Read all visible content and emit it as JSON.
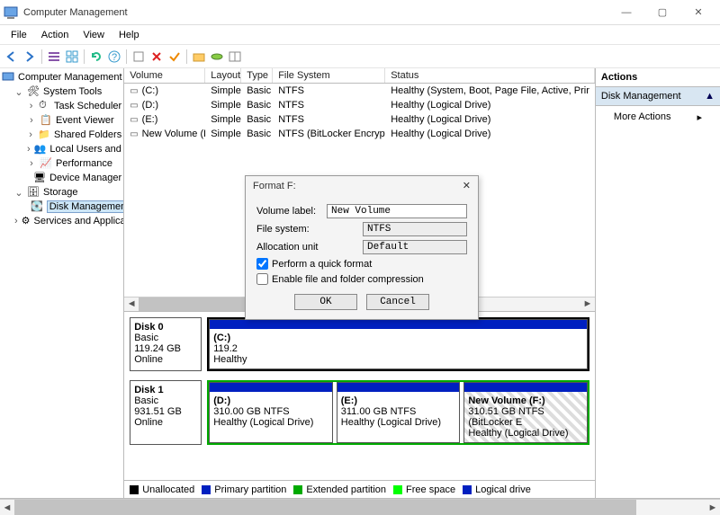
{
  "window": {
    "title": "Computer Management"
  },
  "menu": {
    "items": [
      "File",
      "Action",
      "View",
      "Help"
    ]
  },
  "tree": {
    "root": "Computer Management (Local",
    "sys": "System Tools",
    "sys_children": [
      "Task Scheduler",
      "Event Viewer",
      "Shared Folders",
      "Local Users and Groups",
      "Performance",
      "Device Manager"
    ],
    "storage": "Storage",
    "diskmgmt": "Disk Management",
    "services": "Services and Applications"
  },
  "vol_headers": {
    "v": "Volume",
    "l": "Layout",
    "t": "Type",
    "fs": "File System",
    "s": "Status"
  },
  "volumes": [
    {
      "v": "(C:)",
      "l": "Simple",
      "t": "Basic",
      "fs": "NTFS",
      "s": "Healthy (System, Boot, Page File, Active, Prir"
    },
    {
      "v": "(D:)",
      "l": "Simple",
      "t": "Basic",
      "fs": "NTFS",
      "s": "Healthy (Logical Drive)"
    },
    {
      "v": "(E:)",
      "l": "Simple",
      "t": "Basic",
      "fs": "NTFS",
      "s": "Healthy (Logical Drive)"
    },
    {
      "v": "New Volume (F:)",
      "l": "Simple",
      "t": "Basic",
      "fs": "NTFS (BitLocker Encrypted)",
      "s": "Healthy (Logical Drive)"
    }
  ],
  "disk0": {
    "name": "Disk 0",
    "type": "Basic",
    "size": "119.24 GB",
    "status": "Online",
    "p0": {
      "v": "(C:)",
      "sz": "119.2",
      "st": "Healthy"
    }
  },
  "disk1": {
    "name": "Disk 1",
    "type": "Basic",
    "size": "931.51 GB",
    "status": "Online",
    "p0": {
      "v": "(D:)",
      "sz": "310.00 GB NTFS",
      "st": "Healthy (Logical Drive)"
    },
    "p1": {
      "v": "(E:)",
      "sz": "311.00 GB NTFS",
      "st": "Healthy (Logical Drive)"
    },
    "p2": {
      "v": "New Volume   (F:)",
      "sz": "310.51 GB NTFS (BitLocker E",
      "st": "Healthy (Logical Drive)"
    }
  },
  "legend": {
    "un": "Unallocated",
    "pp": "Primary partition",
    "ep": "Extended partition",
    "fs": "Free space",
    "ld": "Logical drive"
  },
  "actions": {
    "hdr": "Actions",
    "item": "Disk Management",
    "more": "More Actions"
  },
  "dialog": {
    "title": "Format F:",
    "label_lbl": "Volume label:",
    "label_val": "New Volume",
    "fs_lbl": "File system:",
    "fs_val": "NTFS",
    "au_lbl": "Allocation unit",
    "au_val": "Default",
    "quick": "Perform a quick format",
    "compress": "Enable file and folder compression",
    "ok": "OK",
    "cancel": "Cancel"
  }
}
